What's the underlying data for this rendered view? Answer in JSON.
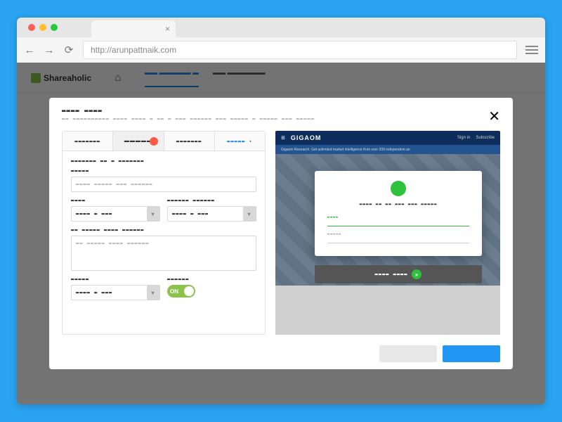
{
  "browser": {
    "url": "http://arunpattnaik.com",
    "tab_close": "×"
  },
  "nav": {
    "back": "←",
    "fwd": "→",
    "reload": "⟳"
  },
  "bg_page": {
    "brand": "Shareaholic",
    "home_icon": "⌂",
    "nav1": "▬▬  ▬▬▬▬▬     ▬",
    "nav2": "▬▬ ▬▬▬▬▬▬"
  },
  "modal": {
    "title": "▬▬▬▬ ▬▬▬▬",
    "subtitle": "▬▬ ▬▬▬▬▬▬▬▬▬▬ ▬▬▬▬ ▬▬▬▬ ▬ ▬▬ ▬ ▬▬▬ ▬▬▬▬▬▬ ▬▬▬ ▬▬▬▬▬ ▬ ▬▬▬▬▬ ▬▬▬ ▬▬▬▬▬",
    "close": "✕",
    "tabs": [
      "▬▬▬▬▬▬▬",
      "▬▬▬▬▬",
      "▬▬▬▬▬▬▬",
      "▬▬▬▬▬ ▾"
    ],
    "section_label": "▬▬▬▬▬▬▬ ▬▬ ▬ ▬▬▬▬▬▬▬",
    "field1_label": "▬▬▬▬▬",
    "field1_placeholder": "▬▬▬▬ ▬▬▬▬▬ ▬▬▬ ▬▬▬▬▬▬",
    "field2_label": "▬▬▬▬",
    "field2_value": "▬▬▬▬ ▬ ▬▬▬",
    "field3_label": "▬▬▬▬▬▬ ▬▬▬▬▬▬",
    "field3_value": "▬▬▬▬ ▬ ▬▬▬",
    "field4_label": "▬▬ ▬▬▬▬▬ ▬▬▬▬ ▬▬▬▬▬▬",
    "field4_placeholder": "▬▬ ▬▬▬▬▬ ▬▬▬▬ ▬▬▬▬▬▬",
    "field5_label": "▬▬▬▬▬",
    "field5_value": "▬▬▬▬ ▬ ▬▬▬",
    "field6_label": "▬▬▬▬▬▬",
    "toggle_on": "ON"
  },
  "preview": {
    "brand": "GIGAOM",
    "signin": "Sign in",
    "subscribe": "Subscribe",
    "banner": "Gigaom Research. Get unlimited market intelligence from over 200 independent an",
    "card_title": "▬▬▬▬ ▬▬ ▬▬ ▬▬▬ ▬▬▬ ▬▬▬▬▬",
    "card_f1": "▬▬▬▬",
    "card_f2": "▬▬▬▬▬",
    "foot": "▬▬▬▬  ▬▬▬▬",
    "foot_go": "»"
  }
}
